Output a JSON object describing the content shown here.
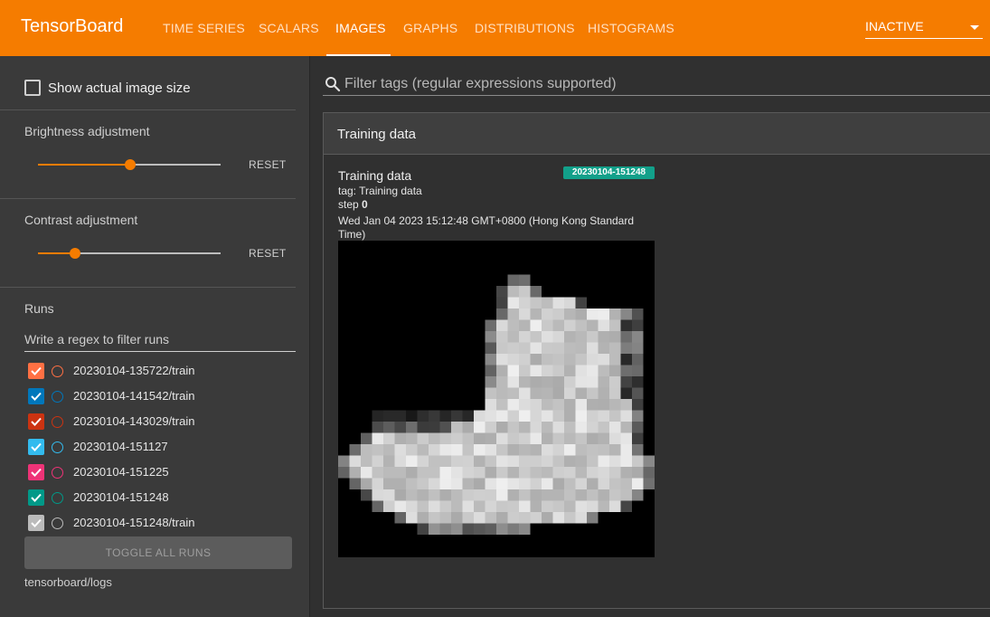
{
  "app": {
    "brand": "TensorBoard",
    "tabs": [
      {
        "label": "TIME SERIES"
      },
      {
        "label": "SCALARS"
      },
      {
        "label": "IMAGES"
      },
      {
        "label": "GRAPHS"
      },
      {
        "label": "DISTRIBUTIONS"
      },
      {
        "label": "HISTOGRAMS"
      }
    ],
    "active_tab": "IMAGES",
    "inactive_select": "INACTIVE"
  },
  "sidebar": {
    "show_actual_size": "Show actual image size",
    "brightness": {
      "label": "Brightness adjustment",
      "value": 0.5,
      "reset": "RESET"
    },
    "contrast": {
      "label": "Contrast adjustment",
      "value": 0.2,
      "reset": "RESET"
    },
    "runs_label": "Runs",
    "runs_filter_placeholder": "Write a regex to filter runs",
    "runs": [
      {
        "name": "20230104-135722/train",
        "color": "#ff7043"
      },
      {
        "name": "20230104-141542/train",
        "color": "#0077bb"
      },
      {
        "name": "20230104-143029/train",
        "color": "#cc3311"
      },
      {
        "name": "20230104-151127",
        "color": "#33bbee"
      },
      {
        "name": "20230104-151225",
        "color": "#ee3377"
      },
      {
        "name": "20230104-151248",
        "color": "#009988"
      },
      {
        "name": "20230104-151248/train",
        "color": "#bbbbbb"
      }
    ],
    "toggle_all": "TOGGLE ALL RUNS",
    "logdir": "tensorboard/logs"
  },
  "main": {
    "filter_placeholder": "Filter tags (regular expressions supported)",
    "card_title": "Training data",
    "image": {
      "title": "Training data",
      "run_badge": "20230104-151248",
      "tag_line": "tag: Training data",
      "step_label": "step",
      "step_value": "0",
      "timestamp": "Wed Jan 04 2023 15:12:48 GMT+0800 (Hong Kong Standard Time)"
    }
  },
  "colors": {
    "accent": "#f57c00",
    "badge": "#12a08a"
  }
}
